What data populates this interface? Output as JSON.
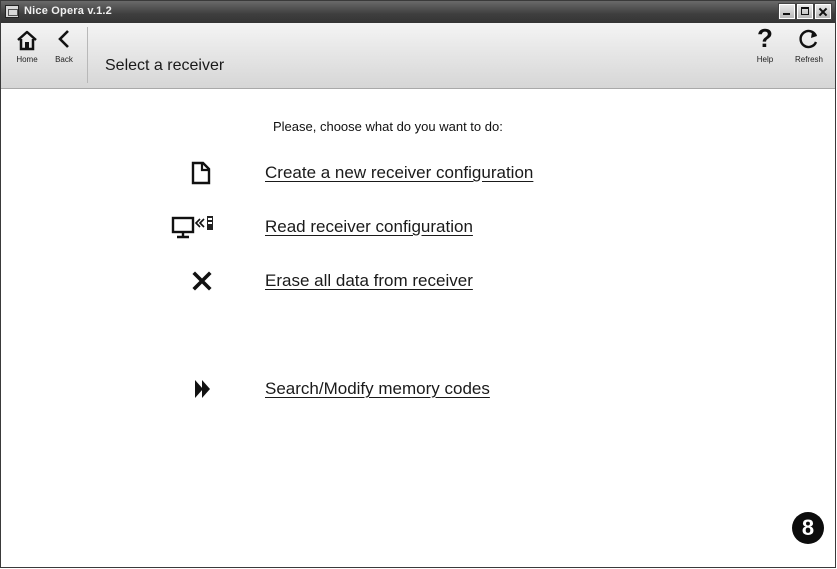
{
  "window": {
    "title": "Nice Opera v.1.2"
  },
  "toolbar": {
    "home_label": "Home",
    "back_label": "Back",
    "page_title": "Select a receiver",
    "help_label": "Help",
    "refresh_label": "Refresh",
    "help_glyph": "?"
  },
  "main": {
    "instruction": "Please, choose what do you want to do:",
    "options": [
      {
        "label": "Create a new receiver configuration",
        "icon": "new-document-icon"
      },
      {
        "label": "Read receiver configuration",
        "icon": "computer-read-icon"
      },
      {
        "label": "Erase all data from receiver",
        "icon": "close-icon"
      },
      {
        "label": "Search/Modify memory codes",
        "icon": "fast-forward-icon"
      }
    ]
  },
  "step_badge": "8",
  "colors": {
    "titlebar": "#3e3e3e",
    "toolbar": "#e2e2e2",
    "text": "#1a1a1a",
    "badge": "#0c0c0c"
  }
}
